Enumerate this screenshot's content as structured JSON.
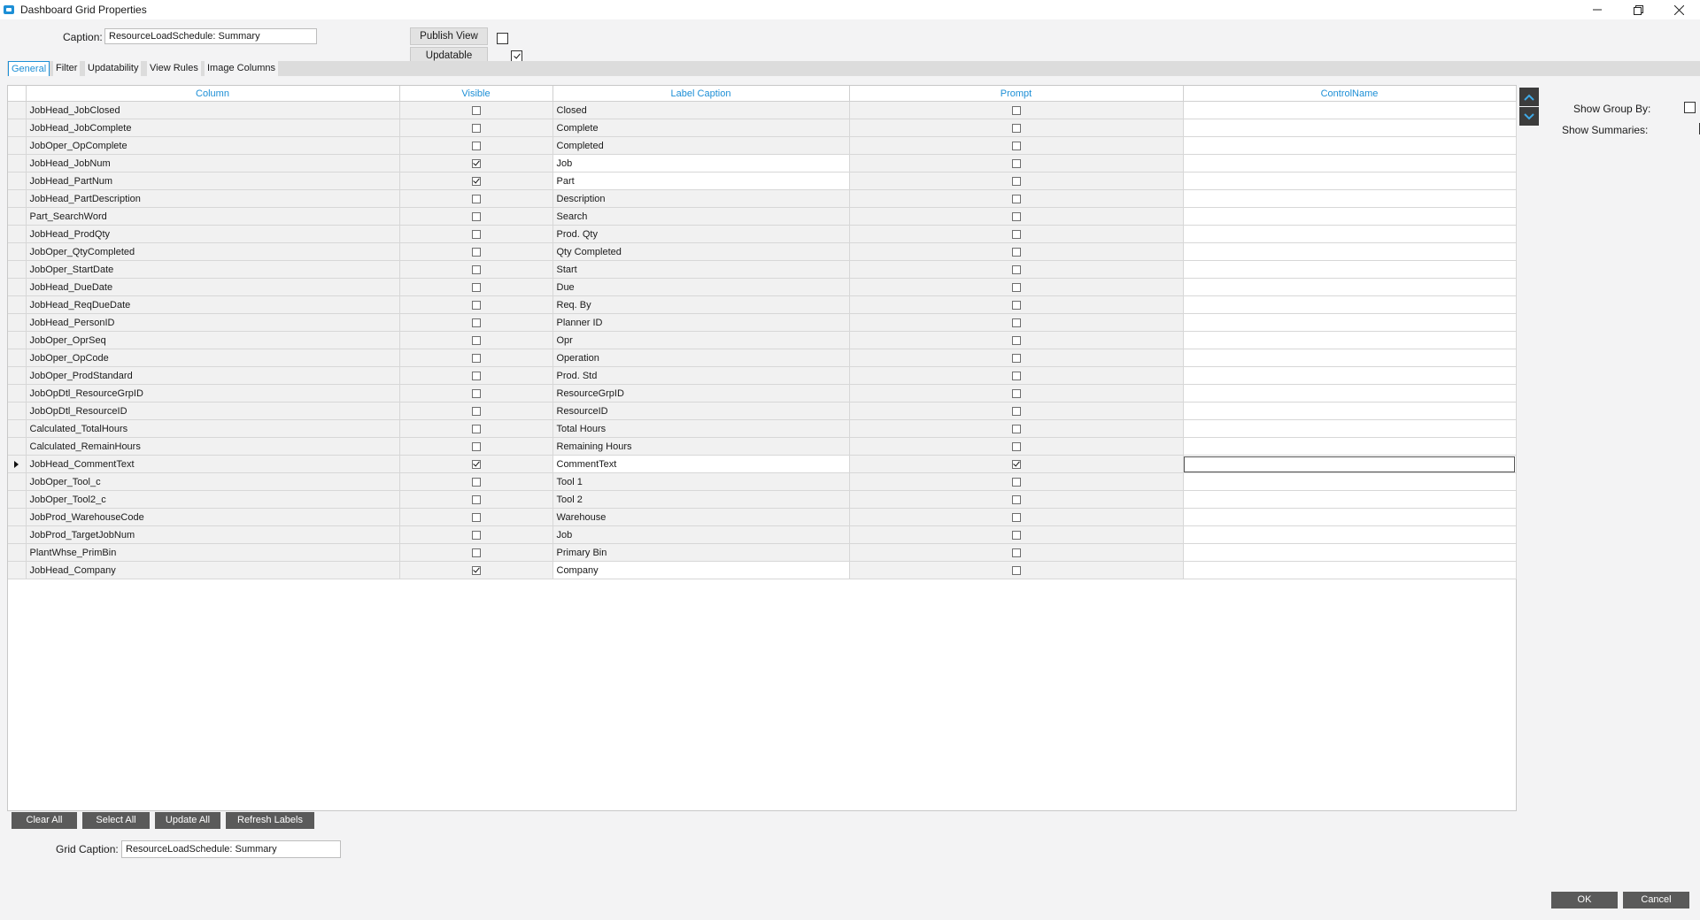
{
  "window": {
    "title": "Dashboard Grid Properties",
    "icon": "app-window-icon",
    "controls": [
      "minimize",
      "maximize",
      "close"
    ]
  },
  "caption": {
    "label": "Caption:",
    "value": "ResourceLoadSchedule: Summary"
  },
  "publish_view": {
    "label": "Publish View",
    "checked": false
  },
  "updatable": {
    "label": "Updatable",
    "checked": true
  },
  "tabs": [
    {
      "label": "General",
      "active": true
    },
    {
      "label": "Filter",
      "active": false
    },
    {
      "label": "Updatability",
      "active": false
    },
    {
      "label": "View Rules",
      "active": false
    },
    {
      "label": "Image Columns",
      "active": false
    }
  ],
  "grid": {
    "headers": {
      "column": "Column",
      "visible": "Visible",
      "label_caption": "Label Caption",
      "prompt": "Prompt",
      "control_name": "ControlName"
    },
    "rows": [
      {
        "column": "JobHead_JobClosed",
        "visible": false,
        "label": "Closed",
        "prompt": false,
        "control": ""
      },
      {
        "column": "JobHead_JobComplete",
        "visible": false,
        "label": "Complete",
        "prompt": false,
        "control": ""
      },
      {
        "column": "JobOper_OpComplete",
        "visible": false,
        "label": "Completed",
        "prompt": false,
        "control": ""
      },
      {
        "column": "JobHead_JobNum",
        "visible": true,
        "label": "Job",
        "prompt": false,
        "control": ""
      },
      {
        "column": "JobHead_PartNum",
        "visible": true,
        "label": "Part",
        "prompt": false,
        "control": ""
      },
      {
        "column": "JobHead_PartDescription",
        "visible": false,
        "label": "Description",
        "prompt": false,
        "control": ""
      },
      {
        "column": "Part_SearchWord",
        "visible": false,
        "label": "Search",
        "prompt": false,
        "control": ""
      },
      {
        "column": "JobHead_ProdQty",
        "visible": false,
        "label": "Prod. Qty",
        "prompt": false,
        "control": ""
      },
      {
        "column": "JobOper_QtyCompleted",
        "visible": false,
        "label": "Qty Completed",
        "prompt": false,
        "control": ""
      },
      {
        "column": "JobOper_StartDate",
        "visible": false,
        "label": "Start",
        "prompt": false,
        "control": ""
      },
      {
        "column": "JobHead_DueDate",
        "visible": false,
        "label": "Due",
        "prompt": false,
        "control": ""
      },
      {
        "column": "JobHead_ReqDueDate",
        "visible": false,
        "label": "Req. By",
        "prompt": false,
        "control": ""
      },
      {
        "column": "JobHead_PersonID",
        "visible": false,
        "label": "Planner ID",
        "prompt": false,
        "control": ""
      },
      {
        "column": "JobOper_OprSeq",
        "visible": false,
        "label": "Opr",
        "prompt": false,
        "control": ""
      },
      {
        "column": "JobOper_OpCode",
        "visible": false,
        "label": "Operation",
        "prompt": false,
        "control": ""
      },
      {
        "column": "JobOper_ProdStandard",
        "visible": false,
        "label": "Prod. Std",
        "prompt": false,
        "control": ""
      },
      {
        "column": "JobOpDtl_ResourceGrpID",
        "visible": false,
        "label": "ResourceGrpID",
        "prompt": false,
        "control": ""
      },
      {
        "column": "JobOpDtl_ResourceID",
        "visible": false,
        "label": "ResourceID",
        "prompt": false,
        "control": ""
      },
      {
        "column": "Calculated_TotalHours",
        "visible": false,
        "label": "Total Hours",
        "prompt": false,
        "control": ""
      },
      {
        "column": "Calculated_RemainHours",
        "visible": false,
        "label": "Remaining Hours",
        "prompt": false,
        "control": ""
      },
      {
        "column": "JobHead_CommentText",
        "visible": true,
        "label": "CommentText",
        "prompt": true,
        "control": "",
        "current": true
      },
      {
        "column": "JobOper_Tool_c",
        "visible": false,
        "label": "Tool 1",
        "prompt": false,
        "control": ""
      },
      {
        "column": "JobOper_Tool2_c",
        "visible": false,
        "label": "Tool 2",
        "prompt": false,
        "control": ""
      },
      {
        "column": "JobProd_WarehouseCode",
        "visible": false,
        "label": "Warehouse",
        "prompt": false,
        "control": ""
      },
      {
        "column": "JobProd_TargetJobNum",
        "visible": false,
        "label": "Job",
        "prompt": false,
        "control": ""
      },
      {
        "column": "PlantWhse_PrimBin",
        "visible": false,
        "label": "Primary Bin",
        "prompt": false,
        "control": ""
      },
      {
        "column": "JobHead_Company",
        "visible": true,
        "label": "Company",
        "prompt": false,
        "control": ""
      }
    ]
  },
  "side_options": {
    "show_group_by": {
      "label": "Show Group By:",
      "checked": false
    },
    "show_summaries": {
      "label": "Show Summaries:",
      "checked": false
    }
  },
  "bottom_buttons": {
    "clear_all": "Clear All",
    "select_all": "Select All",
    "update_all": "Update All",
    "refresh_labels": "Refresh Labels"
  },
  "grid_caption": {
    "label": "Grid Caption:",
    "value": "ResourceLoadSchedule: Summary"
  },
  "dialog_buttons": {
    "ok": "OK",
    "cancel": "Cancel"
  },
  "colors": {
    "accent": "#1d8fd6",
    "dark_button": "#5a5a5a",
    "row_bg": "#f1f1f1"
  }
}
